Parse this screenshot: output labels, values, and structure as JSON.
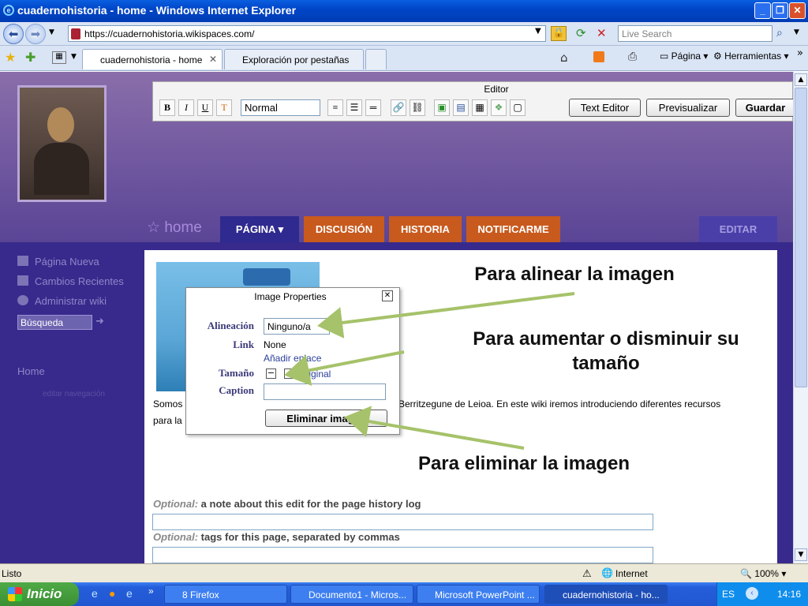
{
  "window": {
    "title": "cuadernohistoria - home - Windows Internet Explorer"
  },
  "browser": {
    "url": "https://cuadernohistoria.wikispaces.com/",
    "search_placeholder": "Live Search",
    "tabs": [
      {
        "label": "cuadernohistoria - home",
        "active": true
      },
      {
        "label": "Exploración por pestañas",
        "active": false
      }
    ],
    "toolbar": {
      "page": "Página",
      "tools": "Herramientas"
    }
  },
  "editor": {
    "title": "Editor",
    "format_value": "Normal",
    "text_editor": "Text Editor",
    "preview": "Previsualizar",
    "save": "Guardar"
  },
  "wiki": {
    "page_name": "home",
    "nav": [
      "PÁGINA",
      "DISCUSIÓN",
      "HISTORIA",
      "NOTIFICARME"
    ],
    "edit": "EDITAR",
    "sidebar": {
      "items": [
        "Página Nueva",
        "Cambios Recientes",
        "Administrar wiki"
      ],
      "search": "Búsqueda",
      "home": "Home",
      "edit_nav": "editar navegación"
    },
    "content": {
      "text_left": "Somos",
      "text_right": "Berritzegune de Leioa. En este wiki iremos introduciendo diferentes recursos",
      "text_line2": "para la",
      "optional_note_prefix": "Optional:",
      "optional_note": "a note about this edit for the page history log",
      "optional_tags_prefix": "Optional:",
      "optional_tags": "tags for this page, separated by commas"
    }
  },
  "dialog": {
    "title": "Image Properties",
    "align_label": "Alineación",
    "align_value": "Ninguno/a",
    "link_label": "Link",
    "link_value": "None",
    "add_link": "Añadir enlace",
    "size_label": "Tamaño",
    "original": "Original",
    "caption_label": "Caption",
    "delete": "Eliminar imagen"
  },
  "annotations": {
    "align": "Para alinear la imagen",
    "resize": "Para aumentar o disminuir su tamaño",
    "delete": "Para eliminar la imagen"
  },
  "status": {
    "text": "Listo",
    "zone": "Internet",
    "zoom": "100%"
  },
  "taskbar": {
    "start": "Inicio",
    "tasks": [
      "8 Firefox",
      "Documento1 - Micros...",
      "Microsoft PowerPoint ...",
      "cuadernohistoria - ho..."
    ],
    "lang": "ES",
    "clock": "14:16"
  },
  "colors": {
    "nav_active": "#2f2a8f",
    "nav_orange": "#c85a1e",
    "edit_tab": "#4a3fa8",
    "arrow": "#a6c26a"
  }
}
